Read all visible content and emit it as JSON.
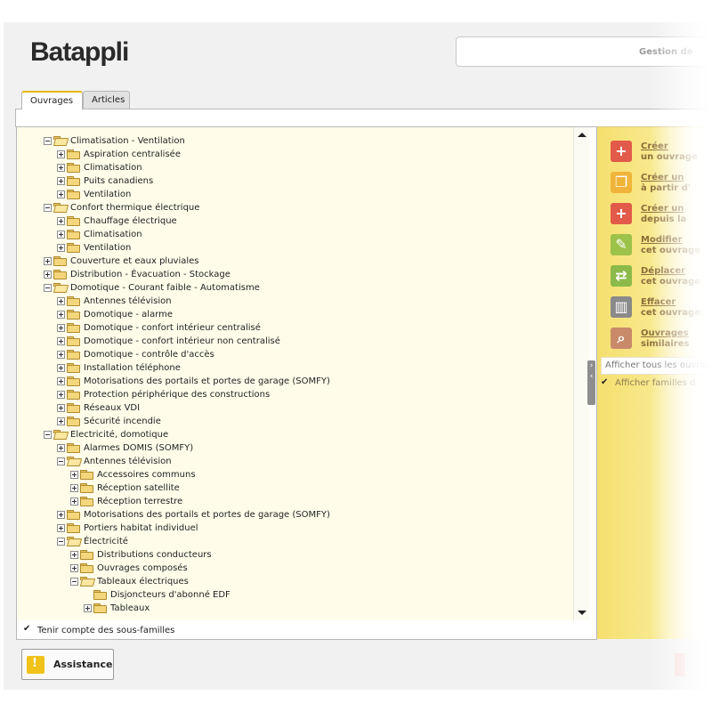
{
  "app": {
    "logo": "Batappli",
    "gestion_label": "Gestion de"
  },
  "tabs": [
    {
      "label": "Ouvrages",
      "active": true
    },
    {
      "label": "Articles",
      "active": false
    }
  ],
  "tree": {
    "rows": [
      {
        "label": "Climatisation - Ventilation",
        "level": 0,
        "expanded": true
      },
      {
        "label": "Aspiration centralisée",
        "level": 1,
        "expanded": false
      },
      {
        "label": "Climatisation",
        "level": 1,
        "expanded": false
      },
      {
        "label": "Puits canadiens",
        "level": 1,
        "expanded": false
      },
      {
        "label": "Ventilation",
        "level": 1,
        "expanded": false
      },
      {
        "label": "Confort thermique électrique",
        "level": 0,
        "expanded": true
      },
      {
        "label": "Chauffage électrique",
        "level": 1,
        "expanded": false
      },
      {
        "label": "Climatisation",
        "level": 1,
        "expanded": false
      },
      {
        "label": "Ventilation",
        "level": 1,
        "expanded": false
      },
      {
        "label": "Couverture et eaux pluviales",
        "level": 0,
        "expanded": false
      },
      {
        "label": "Distribution - Évacuation - Stockage",
        "level": 0,
        "expanded": false
      },
      {
        "label": "Domotique - Courant faible - Automatisme",
        "level": 0,
        "expanded": true
      },
      {
        "label": "Antennes télévision",
        "level": 1,
        "expanded": false
      },
      {
        "label": "Domotique - alarme",
        "level": 1,
        "expanded": false
      },
      {
        "label": "Domotique - confort intérieur centralisé",
        "level": 1,
        "expanded": false
      },
      {
        "label": "Domotique - confort intérieur non centralisé",
        "level": 1,
        "expanded": false
      },
      {
        "label": "Domotique - contrôle d'accès",
        "level": 1,
        "expanded": false
      },
      {
        "label": "Installation téléphone",
        "level": 1,
        "expanded": false
      },
      {
        "label": "Motorisations des portails et portes de garage (SOMFY)",
        "level": 1,
        "expanded": false
      },
      {
        "label": "Protection périphérique des constructions",
        "level": 1,
        "expanded": false
      },
      {
        "label": "Réseaux VDI",
        "level": 1,
        "expanded": false
      },
      {
        "label": "Sécurité incendie",
        "level": 1,
        "expanded": false
      },
      {
        "label": "Electricité, domotique",
        "level": 0,
        "expanded": true
      },
      {
        "label": "Alarmes DOMIS (SOMFY)",
        "level": 1,
        "expanded": false
      },
      {
        "label": "Antennes télévision",
        "level": 1,
        "expanded": true
      },
      {
        "label": "Accessoires communs",
        "level": 2,
        "expanded": false
      },
      {
        "label": "Réception satellite",
        "level": 2,
        "expanded": false
      },
      {
        "label": "Réception terrestre",
        "level": 2,
        "expanded": false
      },
      {
        "label": "Motorisations des portails et portes de garage (SOMFY)",
        "level": 1,
        "expanded": false
      },
      {
        "label": "Portiers habitat individuel",
        "level": 1,
        "expanded": false
      },
      {
        "label": "Électricité",
        "level": 1,
        "expanded": true
      },
      {
        "label": "Distributions conducteurs",
        "level": 2,
        "expanded": false
      },
      {
        "label": "Ouvrages composés",
        "level": 2,
        "expanded": false
      },
      {
        "label": "Tableaux électriques",
        "level": 2,
        "expanded": true
      },
      {
        "label": "Disjoncteurs d'abonné EDF",
        "level": 3,
        "leaf": true
      },
      {
        "label": "Tableaux",
        "level": 3,
        "expanded": false
      }
    ],
    "footer_checkbox": "Tenir compte des sous-familles"
  },
  "actions": [
    {
      "l1": "Créer",
      "l2": "un ouvrage",
      "icon": "plus-icon",
      "color": "#e25a4a"
    },
    {
      "l1": "Créer un",
      "l2": "à partir d'",
      "icon": "copy-icon",
      "color": "#f0b43a"
    },
    {
      "l1": "Créer un",
      "l2": "depuis la",
      "icon": "plus-icon",
      "color": "#e25a4a"
    },
    {
      "l1": "Modifier",
      "l2": "cet ouvrage",
      "icon": "pencil-icon",
      "color": "#9cc24a"
    },
    {
      "l1": "Déplacer",
      "l2": "cet ouvrage",
      "icon": "move-icon",
      "color": "#8cba4a"
    },
    {
      "l1": "Effacer",
      "l2": "cet ouvrage",
      "icon": "trash-icon",
      "color": "#8a8a8a"
    },
    {
      "l1": "Ouvrages",
      "l2": "similaires",
      "icon": "search-icon",
      "color": "#c98a6a"
    }
  ],
  "right_panel": {
    "filter_placeholder": "Afficher tous les ouvrages",
    "check_label": "Afficher familles d"
  },
  "assistance_label": "Assistance"
}
